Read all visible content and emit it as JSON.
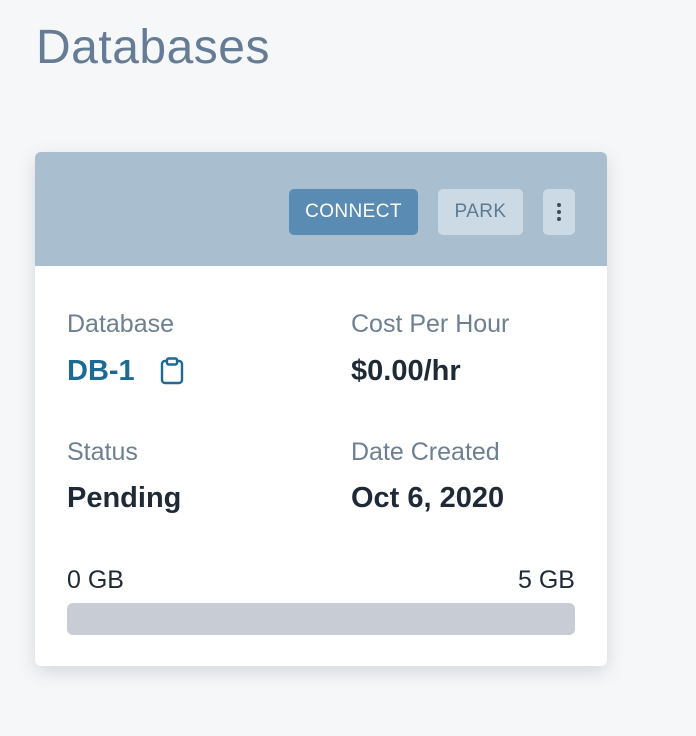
{
  "page": {
    "title": "Databases"
  },
  "card": {
    "actions": {
      "connect_label": "CONNECT",
      "park_label": "PARK",
      "menu_icon": "kebab-menu-icon"
    },
    "database": {
      "label": "Database",
      "value": "DB-1",
      "copy_icon": "clipboard-icon"
    },
    "cost": {
      "label": "Cost Per Hour",
      "value": "$0.00/hr"
    },
    "status": {
      "label": "Status",
      "value": "Pending"
    },
    "date_created": {
      "label": "Date Created",
      "value": "Oct 6, 2020"
    },
    "storage": {
      "min_label": "0 GB",
      "max_label": "5 GB",
      "used_fraction": 0
    }
  },
  "colors": {
    "header_bg": "#a9bfd0",
    "connect_bg": "#5a8cb3",
    "link_blue": "#1d6a94",
    "title_gray": "#667c94"
  }
}
